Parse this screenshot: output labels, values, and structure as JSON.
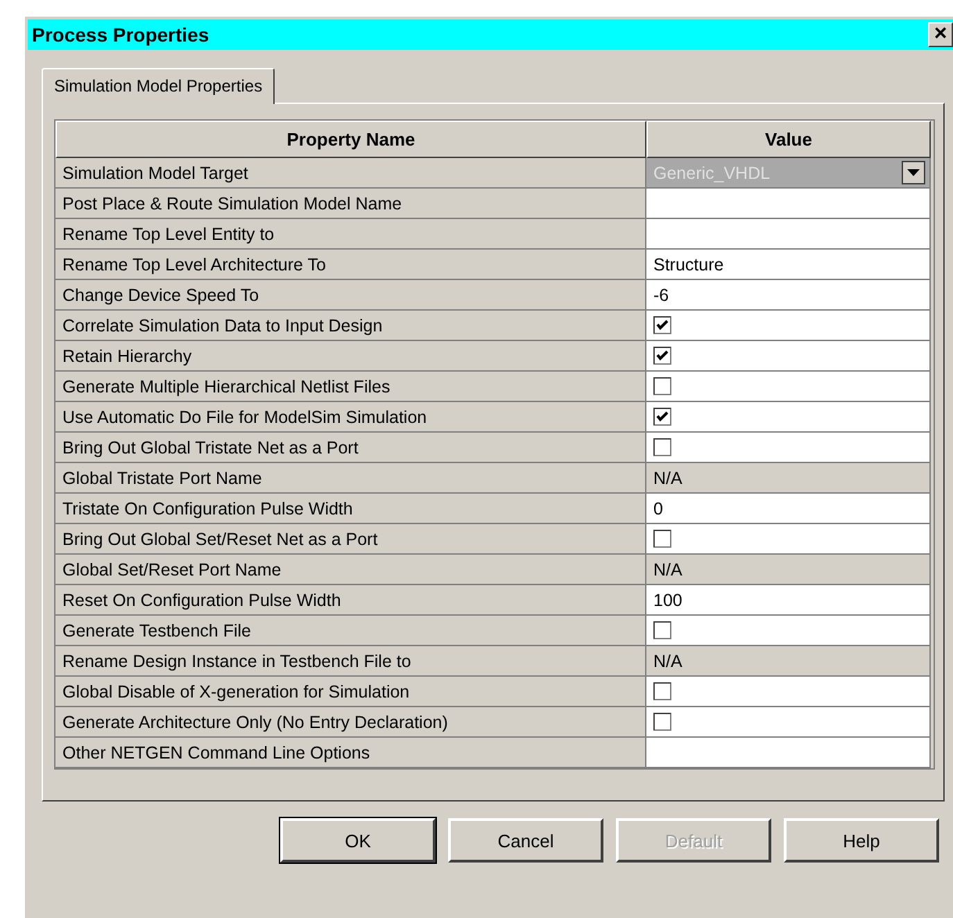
{
  "window": {
    "title": "Process Properties",
    "close": "×"
  },
  "tabs": [
    {
      "label": "Simulation Model Properties",
      "selected": true
    }
  ],
  "table": {
    "columns": [
      "Property Name",
      "Value"
    ],
    "rows": [
      {
        "name": "Simulation Model Target",
        "kind": "dropdown",
        "value": "Generic_VHDL",
        "disabled": true
      },
      {
        "name": "Post Place & Route Simulation Model Name",
        "kind": "text",
        "readonly": false
      },
      {
        "name": "Rename Top Level Entity to",
        "kind": "text",
        "readonly": false
      },
      {
        "name": "Rename Top Level Architecture To",
        "kind": "text",
        "value": "Structure",
        "readonly": false
      },
      {
        "name": "Change Device Speed To",
        "kind": "text",
        "value": "-6",
        "readonly": false
      },
      {
        "name": "Correlate Simulation Data to Input Design",
        "kind": "check",
        "checked": true
      },
      {
        "name": "Retain Hierarchy",
        "kind": "check",
        "checked": true
      },
      {
        "name": "Generate Multiple Hierarchical Netlist Files",
        "kind": "check",
        "checked": false
      },
      {
        "name": "Use Automatic Do File for ModelSim Simulation",
        "kind": "check",
        "checked": true
      },
      {
        "name": "Bring Out Global Tristate Net as a Port",
        "kind": "check",
        "checked": false
      },
      {
        "name": "Global Tristate Port Name",
        "kind": "text",
        "value": "N/A",
        "readonly": true
      },
      {
        "name": "Tristate On Configuration Pulse Width",
        "kind": "text",
        "value": "0",
        "readonly": false
      },
      {
        "name": "Bring Out Global Set/Reset Net as a Port",
        "kind": "check",
        "checked": false
      },
      {
        "name": "Global Set/Reset Port Name",
        "kind": "text",
        "value": "N/A",
        "readonly": true
      },
      {
        "name": "Reset On Configuration Pulse Width",
        "kind": "text",
        "value": "100",
        "readonly": false
      },
      {
        "name": "Generate Testbench File",
        "kind": "check",
        "checked": false
      },
      {
        "name": "Rename Design Instance in Testbench File to",
        "kind": "text",
        "value": "N/A",
        "readonly": true
      },
      {
        "name": "Global Disable of X-generation for Simulation",
        "kind": "check",
        "checked": false
      },
      {
        "name": "Generate Architecture Only (No Entry Declaration)",
        "kind": "check",
        "checked": false
      },
      {
        "name": "Other NETGEN Command Line Options",
        "kind": "text",
        "readonly": false
      }
    ]
  },
  "buttons": [
    {
      "label": "OK",
      "default": true,
      "disabled": false
    },
    {
      "label": "Cancel",
      "default": false,
      "disabled": false
    },
    {
      "label": "Default",
      "default": false,
      "disabled": true
    },
    {
      "label": "Help",
      "default": false,
      "disabled": false
    }
  ]
}
